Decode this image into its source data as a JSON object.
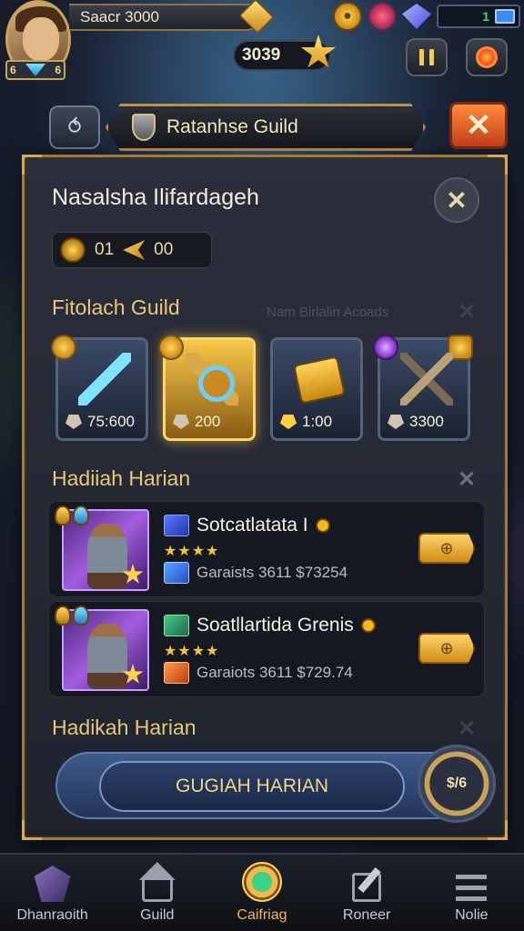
{
  "hud": {
    "player_name": "Saacr 3000",
    "avatar_level_left": "6",
    "avatar_level_right": "6",
    "gold": "3039",
    "energy_value": "1"
  },
  "banner": {
    "title": "Ratanhse Guild",
    "back_glyph": "⥀",
    "close_glyph": "✕"
  },
  "panel": {
    "title": "Nasalsha Ilifardageh",
    "close_glyph": "✕",
    "stat_a": "01",
    "stat_b": "00",
    "shop_section": {
      "title": "Fitolach Guild",
      "faded_label": "Nam Birlalin Acoads",
      "close_glyph": "✕",
      "items": [
        {
          "price": "75:600",
          "icon": "wand-icon"
        },
        {
          "price": "200",
          "icon": "hammer-icon",
          "selected": true
        },
        {
          "price": "1:00",
          "icon": "chest-icon"
        },
        {
          "price": "3300",
          "icon": "bow-icon"
        }
      ]
    },
    "daily_section": {
      "title": "Hadiiah Harian",
      "close_glyph": "✕",
      "quests": [
        {
          "title": "Sotcatlatata I",
          "stars": "★★★★",
          "sub": "Garaists  3611  $73254",
          "go_glyph": "⊕"
        },
        {
          "title": "Soatllartida Grenis",
          "stars": "★★★★",
          "sub": "Garaiots  3611  $729.74",
          "go_glyph": "⊕"
        }
      ]
    },
    "footer_section": {
      "title": "Hadikah Harian",
      "close_glyph": "✕"
    },
    "claim_button": "GUGIAH HARIAN",
    "claim_badge": "$/6"
  },
  "nav": {
    "items": [
      {
        "label": "Dhanraoith",
        "icon": "crystal-icon"
      },
      {
        "label": "Guild",
        "icon": "guild-hall-icon"
      },
      {
        "label": "Caifriag",
        "icon": "crafting-icon",
        "active": true
      },
      {
        "label": "Roneer",
        "icon": "edit-icon"
      },
      {
        "label": "Nolie",
        "icon": "menu-icon"
      }
    ]
  },
  "colors": {
    "accent_gold": "#e9c77a",
    "panel_border": "#9b7a45",
    "close_orange": "#ff8a3c",
    "active_nav": "#f1b84a"
  }
}
